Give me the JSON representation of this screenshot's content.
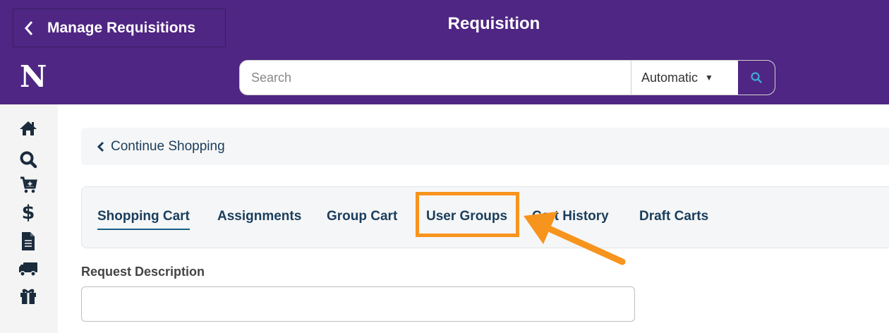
{
  "header": {
    "back_label": "Manage Requisitions",
    "title": "Requisition"
  },
  "navbar": {
    "logo": "N",
    "search": {
      "placeholder": "Search",
      "value": ""
    },
    "scope": {
      "selected": "Automatic"
    }
  },
  "sidebar": {
    "icons": [
      "home-icon",
      "search-icon",
      "cart-icon",
      "dollar-icon",
      "document-icon",
      "truck-icon",
      "gift-icon"
    ]
  },
  "continue": {
    "label": "Continue Shopping"
  },
  "tabs": [
    {
      "label": "Shopping Cart",
      "active": true
    },
    {
      "label": "Assignments",
      "active": false
    },
    {
      "label": "Group Cart",
      "active": false
    },
    {
      "label": "User Groups",
      "active": false
    },
    {
      "label": "Cart History",
      "active": false
    },
    {
      "label": "Draft Carts",
      "active": false
    }
  ],
  "form": {
    "request_description_label": "Request Description",
    "request_description_value": ""
  },
  "colors": {
    "brand_purple": "#4f2683",
    "link_navy": "#1a3d5c",
    "highlight_orange": "#f7941d"
  }
}
